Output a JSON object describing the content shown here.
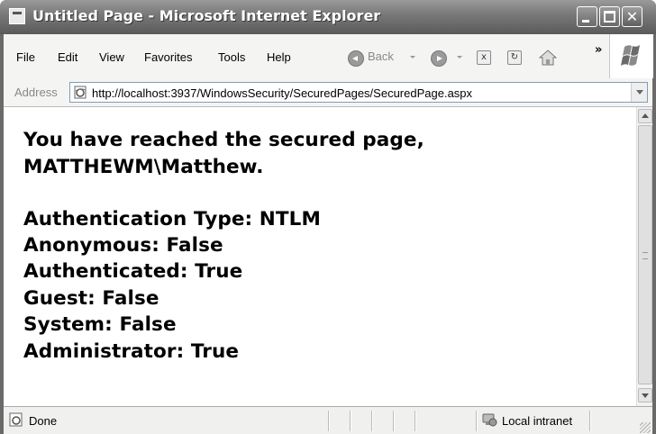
{
  "window": {
    "title": "Untitled Page - Microsoft Internet Explorer"
  },
  "menu": {
    "items": [
      "File",
      "Edit",
      "View",
      "Favorites",
      "Tools",
      "Help"
    ],
    "back_label": "Back",
    "overflow_glyph": "»"
  },
  "address": {
    "label": "Address",
    "url": "http://localhost:3937/WindowsSecurity/SecuredPages/SecuredPage.aspx"
  },
  "content": {
    "line1": "You have reached the secured page,",
    "line2": "MATTHEWM\\Matthew.",
    "fields": [
      "Authentication Type: NTLM",
      "Anonymous: False",
      "Authenticated: True",
      "Guest: False",
      "System: False",
      "Administrator: True"
    ]
  },
  "status": {
    "text": "Done",
    "zone": "Local intranet"
  },
  "icons": {
    "title": "ie-page-icon",
    "back": "back-arrow-icon",
    "forward": "forward-arrow-icon",
    "stop": "stop-icon",
    "refresh": "refresh-icon",
    "home": "home-icon"
  }
}
